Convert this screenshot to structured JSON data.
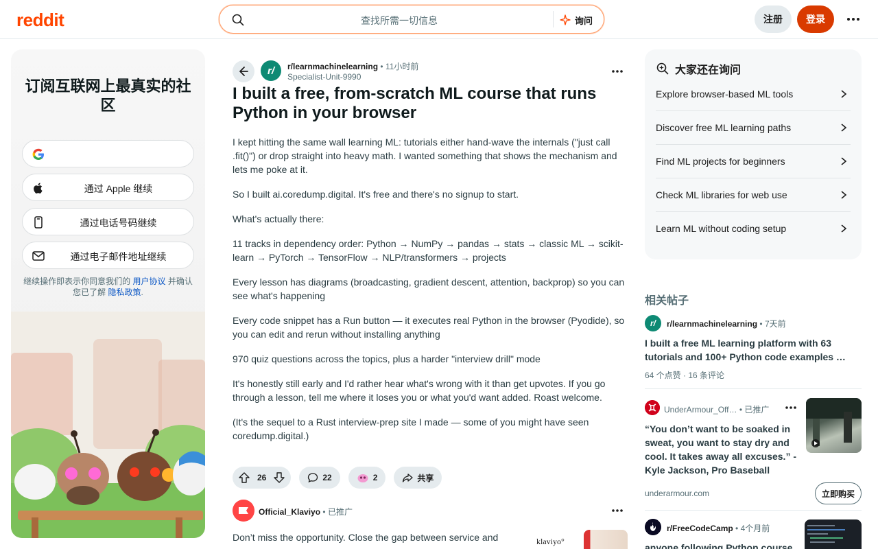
{
  "header": {
    "logo": "reddit",
    "search_placeholder": "查找所需一切信息",
    "ask_label": "询问",
    "register_label": "注册",
    "login_label": "登录"
  },
  "signup": {
    "title": "订阅互联网上最真实的社区",
    "google_label": "",
    "apple_label": "通过 Apple 继续",
    "phone_label": "通过电话号码继续",
    "email_label": "通过电子邮件地址继续",
    "terms_prefix": "继续操作即表示你同意我们的",
    "terms_link": "用户协议",
    "terms_mid": "并确认您已了解",
    "privacy_link": "隐私政策",
    "terms_end": "."
  },
  "post": {
    "subreddit": "r/learnmachinelearning",
    "time": "11小时前",
    "author": "Specialist-Unit-9990",
    "title": "I built a free, from-scratch ML course that runs Python in your browser",
    "paragraphs": [
      "I kept hitting the same wall learning ML: tutorials either hand-wave the internals (\"just call .fit()\") or drop straight into heavy math. I wanted something that shows the mechanism and lets me poke at it.",
      "So I built ai.coredump.digital. It's free and there's no signup to start.",
      "What's actually there:",
      "11 tracks in dependency order: Python → NumPy → pandas → stats → classic ML → scikit-learn → PyTorch → TensorFlow → NLP/transformers → projects",
      "Every lesson has diagrams (broadcasting, gradient descent, attention, backprop) so you can see what's happening",
      "Every code snippet has a Run button — it executes real Python in the browser (Pyodide), so you can edit and rerun without installing anything",
      "970 quiz questions across the topics, plus a harder \"interview drill\" mode",
      "It's honestly still early and I'd rather hear what's wrong with it than get upvotes. If you go through a lesson, tell me where it loses you or what you'd want added. Roast welcome.",
      "(It's the sequel to a Rust interview-prep site I made — some of you might have seen coredump.digital.)"
    ],
    "votes": "26",
    "comments": "22",
    "awards": "2",
    "share_label": "共享"
  },
  "ad": {
    "advertiser": "Official_Klaviyo",
    "promoted": "已推广",
    "text": "Don’t miss the opportunity. Close the gap between service and",
    "brand": "klaviyo°"
  },
  "ask_card": {
    "title": "大家还在询问",
    "items": [
      "Explore browser-based ML tools",
      "Discover free ML learning paths",
      "Find ML projects for beginners",
      "Check ML libraries for web use",
      "Learn ML without coding setup"
    ]
  },
  "related": {
    "heading": "相关帖子",
    "post1": {
      "subreddit": "r/learnmachinelearning",
      "time": "7天前",
      "title": "I built a free ML learning platform with 63 tutorials and 100+ Python code examples …",
      "upvotes": "64 个点赞",
      "comments": "16 条评论"
    },
    "ad2": {
      "advertiser": "UnderArmour_Off…",
      "promoted": "已推广",
      "title": "“You don’t want to be soaked in sweat, you want to stay dry and cool. It takes away all excuses.” - Kyle Jackson, Pro Baseball",
      "domain": "underarmour.com",
      "cta": "立即购买"
    },
    "post3": {
      "subreddit": "r/FreeCodeCamp",
      "time": "4个月前",
      "title": "anyone following Python course"
    }
  },
  "colors": {
    "brand": "#ff4500",
    "login": "#d93a00",
    "link": "#0a56c4"
  }
}
